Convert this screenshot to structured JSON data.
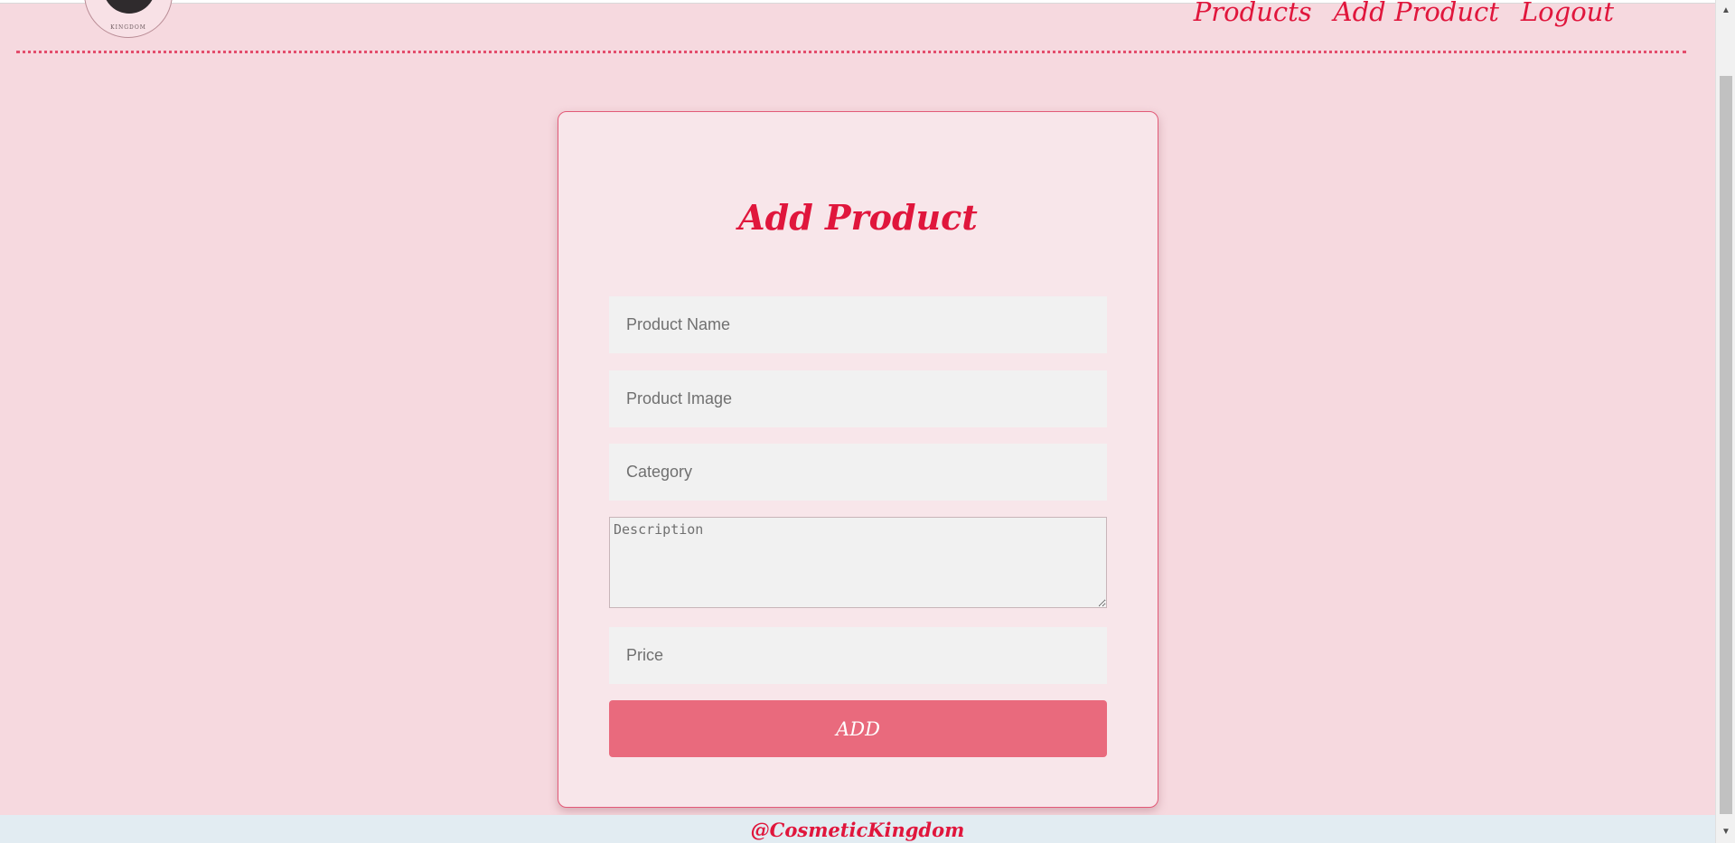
{
  "brand": {
    "logo_icon": "cosmetic-kingdom-logo",
    "logo_text": "KINGDOM"
  },
  "nav": {
    "items": [
      {
        "label": "Products"
      },
      {
        "label": "Add Product"
      },
      {
        "label": "Logout"
      }
    ]
  },
  "form": {
    "title": "Add Product",
    "product_name_placeholder": "Product Name",
    "product_image_placeholder": "Product Image",
    "category_placeholder": "Category",
    "description_placeholder": "Description",
    "price_placeholder": "Price",
    "submit_label": "ADD"
  },
  "footer": {
    "text": "@CosmeticKingdom"
  },
  "colors": {
    "background": "#f6d9df",
    "accent": "#e0163c",
    "button": "#e96a7d",
    "footer_bg": "#e2ecf2"
  }
}
